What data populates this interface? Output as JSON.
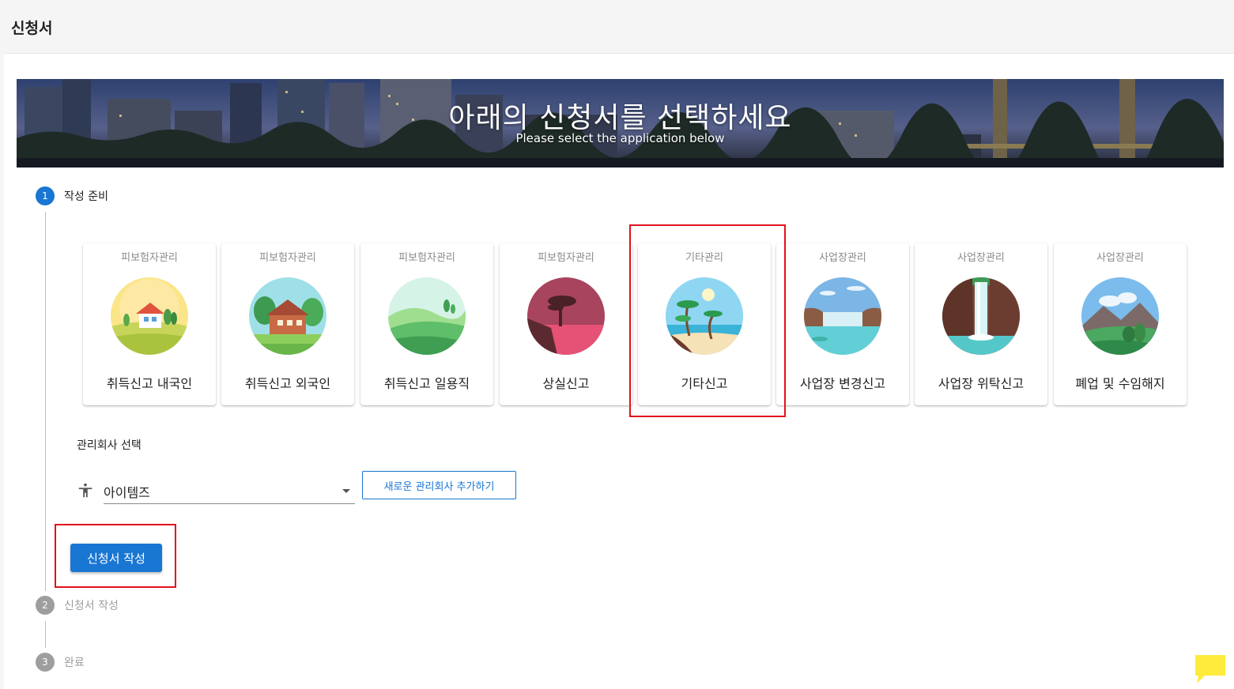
{
  "header": {
    "title": "신청서"
  },
  "banner": {
    "title": "아래의 신청서를 선택하세요",
    "subtitle": "Please select the application below"
  },
  "steps": [
    {
      "number": "1",
      "label": "작성 준비",
      "state": "active"
    },
    {
      "number": "2",
      "label": "신청서 작성",
      "state": "inactive"
    },
    {
      "number": "3",
      "label": "완료",
      "state": "inactive"
    }
  ],
  "cards": [
    {
      "category": "피보험자관리",
      "name": "취득신고 내국인",
      "image": "house-field-icon"
    },
    {
      "category": "피보험자관리",
      "name": "취득신고 외국인",
      "image": "cabin-forest-icon"
    },
    {
      "category": "피보험자관리",
      "name": "취득신고 일용직",
      "image": "green-hills-icon"
    },
    {
      "category": "피보험자관리",
      "name": "상실신고",
      "image": "lone-tree-sunset-icon"
    },
    {
      "category": "기타관리",
      "name": "기타신고",
      "image": "palm-beach-icon"
    },
    {
      "category": "사업장관리",
      "name": "사업장 변경신고",
      "image": "lake-waterfall-icon"
    },
    {
      "category": "사업장관리",
      "name": "사업장 위탁신고",
      "image": "canyon-waterfall-icon"
    },
    {
      "category": "사업장관리",
      "name": "폐업 및 수임해지",
      "image": "mountain-geyser-icon"
    }
  ],
  "company": {
    "section_label": "관리회사 선택",
    "selected": "아이템즈",
    "add_button": "새로운 관리회사 추가하기"
  },
  "actions": {
    "create_button": "신청서 작성"
  },
  "colors": {
    "accent": "#1976d2",
    "highlight": "#e0131c",
    "chat": "#ffeb3b"
  }
}
